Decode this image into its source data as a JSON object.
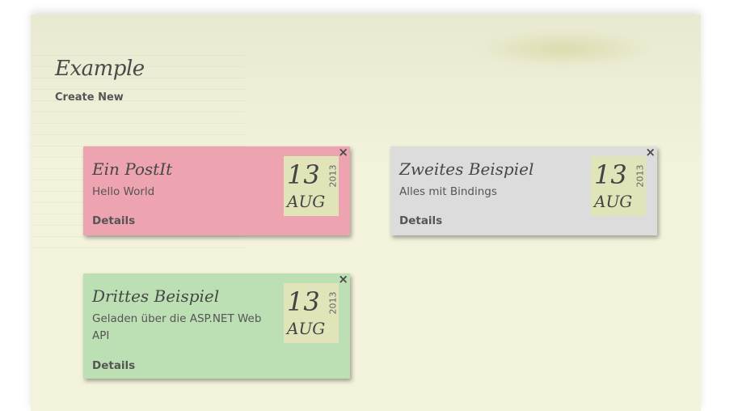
{
  "page": {
    "title": "Example",
    "create_new": "Create New"
  },
  "notes": [
    {
      "title": "Ein PostIt",
      "text": "Hello World",
      "details": "Details",
      "close": "×",
      "day": "13",
      "month": "AUG",
      "year": "2013",
      "color": "#eea4b0"
    },
    {
      "title": "Zweites Beispiel",
      "text": "Alles mit Bindings",
      "details": "Details",
      "close": "×",
      "day": "13",
      "month": "AUG",
      "year": "2013",
      "color": "#dcdcdc"
    },
    {
      "title": "Drittes Beispiel",
      "text": "Geladen über die ASP.NET Web API",
      "details": "Details",
      "close": "×",
      "day": "13",
      "month": "AUG",
      "year": "2013",
      "color": "#bcdfb3"
    }
  ]
}
